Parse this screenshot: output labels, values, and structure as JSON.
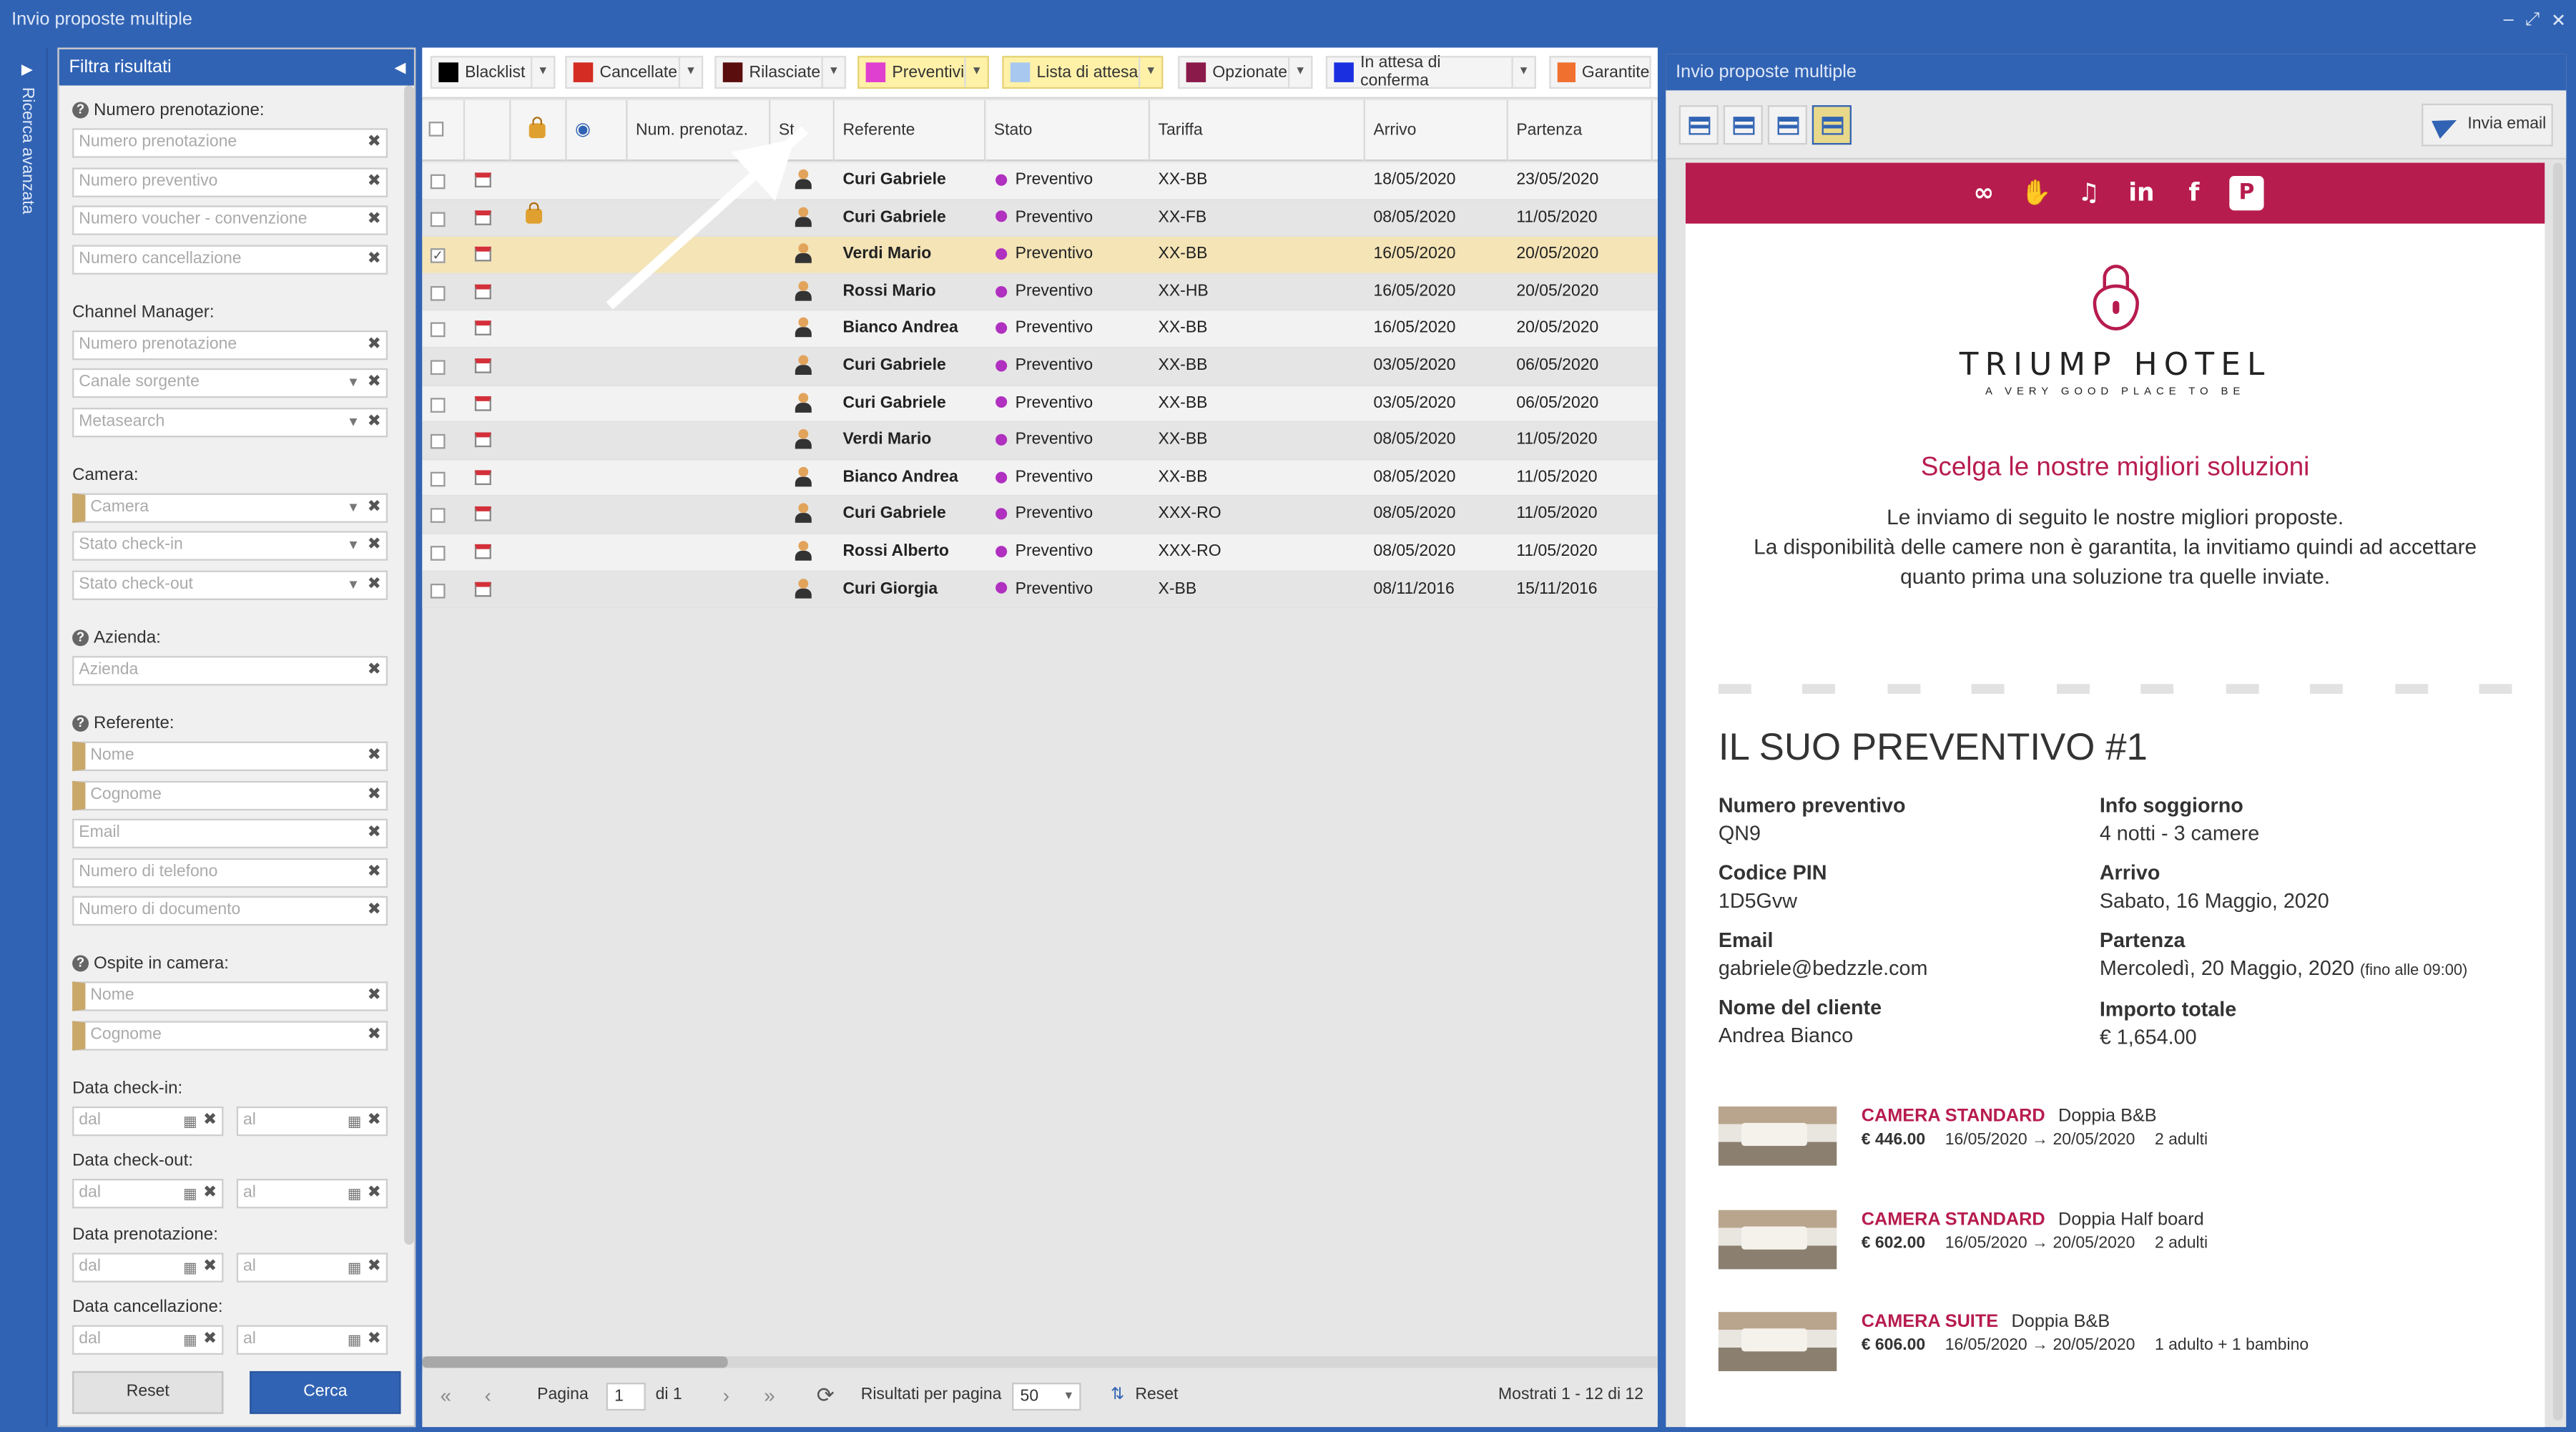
{
  "window": {
    "title": "Invio proposte multiple",
    "controls": [
      "‒",
      "⤢",
      "✕"
    ]
  },
  "rail": {
    "label": "Ricerca avanzata"
  },
  "filter": {
    "title": "Filtra risultati",
    "sections": {
      "numero_prenotazione": "Numero prenotazione:",
      "channel_manager": "Channel Manager:",
      "camera": "Camera:",
      "azienda": "Azienda:",
      "referente": "Referente:",
      "ospite": "Ospite in camera:",
      "checkin": "Data check-in:",
      "checkout": "Data check-out:",
      "prenotazione": "Data prenotazione:",
      "cancellazione": "Data cancellazione:"
    },
    "placeholders": {
      "num_pren": "Numero prenotazione",
      "num_prev": "Numero preventivo",
      "voucher": "Numero voucher - convenzione",
      "num_canc": "Numero cancellazione",
      "cm_num": "Numero prenotazione",
      "canale": "Canale sorgente",
      "meta": "Metasearch",
      "camera": "Camera",
      "stato_in": "Stato check-in",
      "stato_out": "Stato check-out",
      "azienda": "Azienda",
      "nome": "Nome",
      "cognome": "Cognome",
      "email": "Email",
      "telefono": "Numero di telefono",
      "documento": "Numero di documento",
      "osp_nome": "Nome",
      "osp_cognome": "Cognome",
      "dal": "dal",
      "al": "al"
    },
    "reset_label": "Reset",
    "search_label": "Cerca"
  },
  "toolbar": {
    "filters": [
      {
        "label": "Blacklist",
        "color": "#000000"
      },
      {
        "label": "Cancellate",
        "color": "#d42b22"
      },
      {
        "label": "Rilasciate",
        "color": "#5a0e0e"
      },
      {
        "label": "Preventivi",
        "color": "#e040d0"
      },
      {
        "label": "Lista di attesa",
        "color": "#a9c8f0"
      },
      {
        "label": "Opzionate",
        "color": "#8a1a4a"
      },
      {
        "label": "In attesa di conferma",
        "color": "#1a30e0"
      },
      {
        "label": "Garantite",
        "color": "#f07030"
      }
    ]
  },
  "grid": {
    "columns": {
      "num": "Num. prenotaz.",
      "st": "St...",
      "referente": "Referente",
      "stato": "Stato",
      "tariffa": "Tariffa",
      "arrivo": "Arrivo",
      "partenza": "Partenza"
    },
    "rows": [
      {
        "referente": "Curi Gabriele",
        "stato": "Preventivo",
        "tariffa": "XX-BB",
        "arrivo": "18/05/2020",
        "partenza": "23/05/2020"
      },
      {
        "referente": "Curi Gabriele",
        "stato": "Preventivo",
        "tariffa": "XX-FB",
        "arrivo": "08/05/2020",
        "partenza": "11/05/2020"
      },
      {
        "referente": "Verdi Mario",
        "stato": "Preventivo",
        "tariffa": "XX-BB",
        "arrivo": "16/05/2020",
        "partenza": "20/05/2020"
      },
      {
        "referente": "Rossi Mario",
        "stato": "Preventivo",
        "tariffa": "XX-HB",
        "arrivo": "16/05/2020",
        "partenza": "20/05/2020"
      },
      {
        "referente": "Bianco Andrea",
        "stato": "Preventivo",
        "tariffa": "XX-BB",
        "arrivo": "16/05/2020",
        "partenza": "20/05/2020"
      },
      {
        "referente": "Curi Gabriele",
        "stato": "Preventivo",
        "tariffa": "XX-BB",
        "arrivo": "03/05/2020",
        "partenza": "06/05/2020"
      },
      {
        "referente": "Curi Gabriele",
        "stato": "Preventivo",
        "tariffa": "XX-BB",
        "arrivo": "03/05/2020",
        "partenza": "06/05/2020"
      },
      {
        "referente": "Verdi Mario",
        "stato": "Preventivo",
        "tariffa": "XX-BB",
        "arrivo": "08/05/2020",
        "partenza": "11/05/2020"
      },
      {
        "referente": "Bianco Andrea",
        "stato": "Preventivo",
        "tariffa": "XX-BB",
        "arrivo": "08/05/2020",
        "partenza": "11/05/2020"
      },
      {
        "referente": "Curi Gabriele",
        "stato": "Preventivo",
        "tariffa": "XXX-RO",
        "arrivo": "08/05/2020",
        "partenza": "11/05/2020"
      },
      {
        "referente": "Rossi Alberto",
        "stato": "Preventivo",
        "tariffa": "XXX-RO",
        "arrivo": "08/05/2020",
        "partenza": "11/05/2020"
      },
      {
        "referente": "Curi Giorgia",
        "stato": "Preventivo",
        "tariffa": "X-BB",
        "arrivo": "08/11/2016",
        "partenza": "15/11/2016"
      }
    ],
    "selected_row": 3,
    "locked_row": 2
  },
  "pager": {
    "page_label": "Pagina",
    "page_value": "1",
    "of_label": "di 1",
    "per_page_label": "Risultati per pagina",
    "per_page_value": "50",
    "reset_label": "Reset",
    "summary": "Mostrati 1 - 12 di 12"
  },
  "right": {
    "title": "Invio proposte multiple",
    "send_label": "Invia email",
    "preview": {
      "social": [
        "tripadvisor-icon",
        "thumbs-up-icon",
        "twitter-icon",
        "linkedin-icon",
        "facebook-icon",
        "pinterest-icon"
      ],
      "hotel_name": "TRIUMP HOTEL",
      "hotel_tagline": "A VERY GOOD PLACE TO BE",
      "headline": "Scelga le nostre migliori soluzioni",
      "intro_line1": "Le inviamo di seguito le nostre migliori proposte.",
      "intro_line2": "La disponibilità delle camere non è garantita, la invitiamo quindi ad accettare quanto prima una soluzione tra quelle inviate.",
      "quote_title": "IL SUO PREVENTIVO #1",
      "left_info": [
        {
          "label": "Numero preventivo",
          "value": "QN9"
        },
        {
          "label": "Codice PIN",
          "value": "1D5Gvw"
        },
        {
          "label": "Email",
          "value": "gabriele@bedzzle.com"
        },
        {
          "label": "Nome del cliente",
          "value": "Andrea Bianco"
        }
      ],
      "right_info": [
        {
          "label": "Info soggiorno",
          "value": "4 notti - 3 camere"
        },
        {
          "label": "Arrivo",
          "value": "Sabato, 16 Maggio, 2020"
        },
        {
          "label": "Partenza",
          "value": "Mercoledì, 20 Maggio, 2020",
          "note": "(fino alle 09:00)"
        },
        {
          "label": "Importo totale",
          "value": "€ 1,654.00"
        }
      ],
      "rooms": [
        {
          "name": "CAMERA STANDARD",
          "board": "Doppia B&B",
          "price": "€ 446.00",
          "dates": "16/05/2020 → 20/05/2020",
          "occupancy": "2 adulti"
        },
        {
          "name": "CAMERA STANDARD",
          "board": "Doppia Half board",
          "price": "€ 602.00",
          "dates": "16/05/2020 → 20/05/2020",
          "occupancy": "2 adulti"
        },
        {
          "name": "CAMERA SUITE",
          "board": "Doppia B&B",
          "price": "€ 606.00",
          "dates": "16/05/2020 → 20/05/2020",
          "occupancy": "1 adulto + 1 bambino"
        }
      ]
    }
  }
}
